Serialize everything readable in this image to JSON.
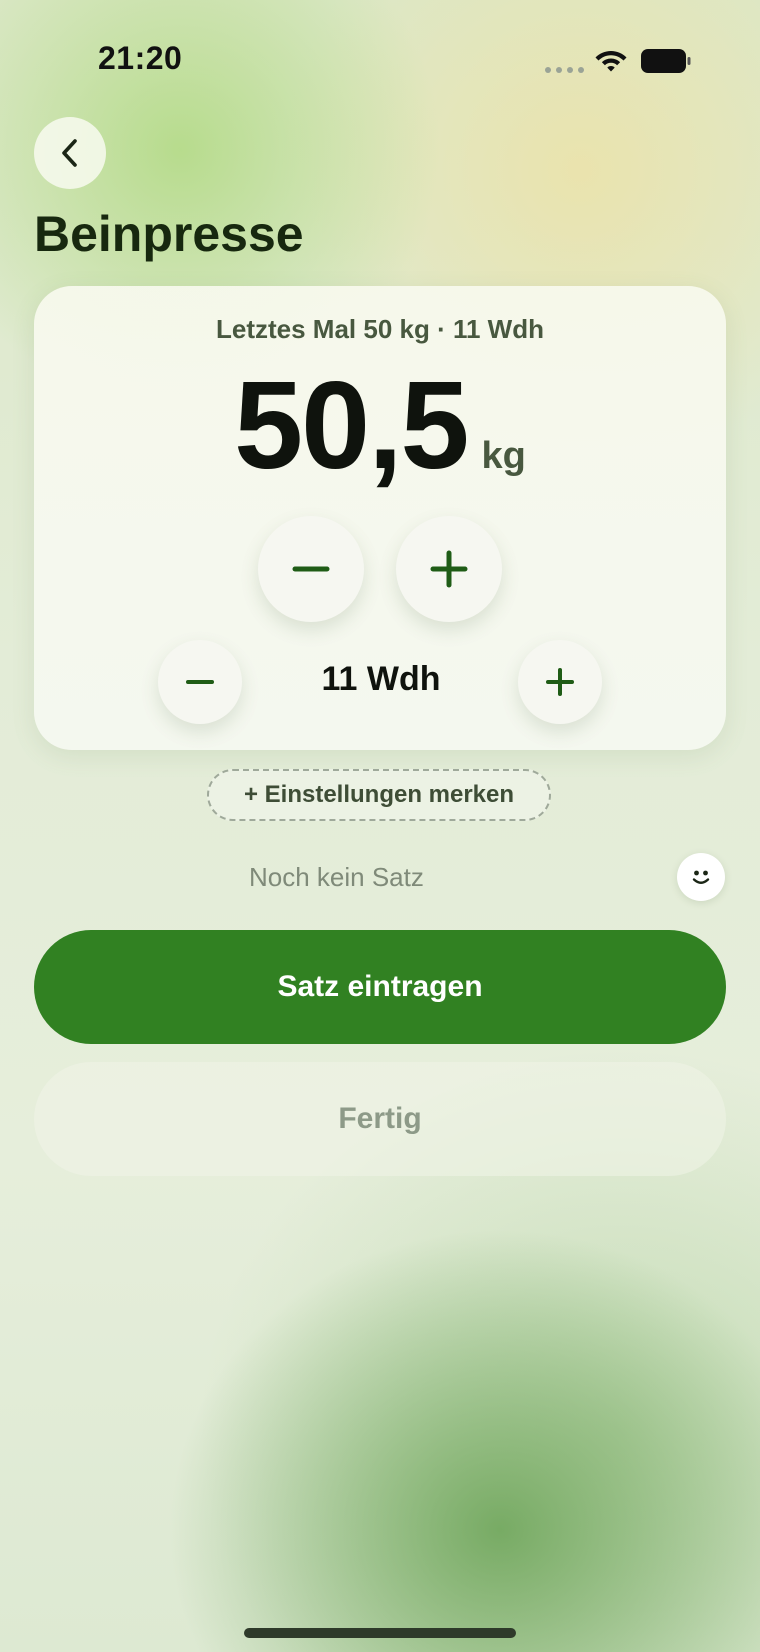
{
  "status_bar": {
    "time": "21:20",
    "icons": [
      "signal-dots-icon",
      "wifi-icon",
      "battery-icon"
    ]
  },
  "header": {
    "back_icon": "chevron-left-icon",
    "title": "Beinpresse"
  },
  "exercise_card": {
    "last_time": "Letztes Mal 50 kg · 11 Wdh",
    "weight_value": "50,5",
    "weight_unit": "kg",
    "weight_decrease_icon": "minus-icon",
    "weight_increase_icon": "plus-icon",
    "reps_value": "11 Wdh",
    "reps_decrease_icon": "minus-icon",
    "reps_increase_icon": "plus-icon"
  },
  "remember_settings": {
    "label": "+ Einstellungen merken"
  },
  "sets": {
    "empty_text": "Noch kein Satz",
    "mood_icon": "smiley-icon"
  },
  "actions": {
    "log_set_label": "Satz eintragen",
    "done_label": "Fertig"
  },
  "colors": {
    "accent": "#318122",
    "icon_green": "#1f5c16",
    "title": "#17280f"
  }
}
